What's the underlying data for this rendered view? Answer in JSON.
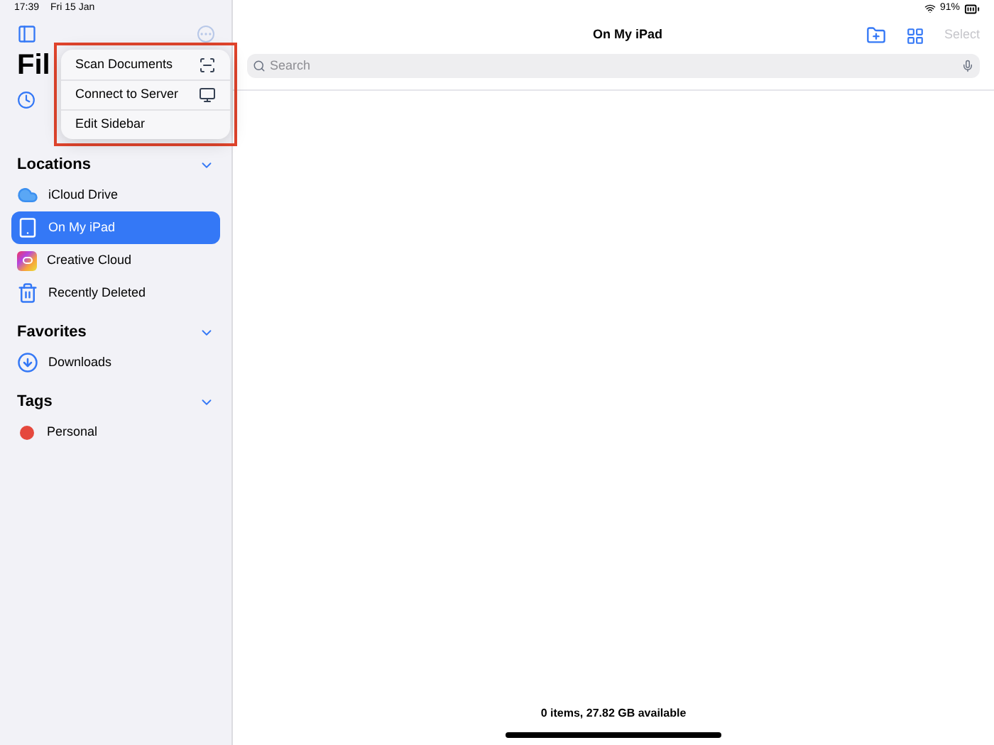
{
  "status_bar": {
    "time": "17:39",
    "date": "Fri 15 Jan",
    "battery": "91%"
  },
  "sidebar": {
    "title": "Fil",
    "sections": [
      {
        "title": "Locations",
        "expanded": true,
        "items": [
          {
            "label": "iCloud Drive",
            "kind": "cloud",
            "selected": false
          },
          {
            "label": "On My iPad",
            "kind": "device",
            "selected": true
          },
          {
            "label": "Creative Cloud",
            "kind": "app",
            "selected": false
          },
          {
            "label": "Recently Deleted",
            "kind": "trash",
            "selected": false
          }
        ]
      },
      {
        "title": "Favorites",
        "expanded": true,
        "items": [
          {
            "label": "Downloads",
            "kind": "download",
            "selected": false
          }
        ]
      },
      {
        "title": "Tags",
        "expanded": true,
        "items": [
          {
            "label": "Personal",
            "kind": "tag",
            "color": "#e5483d",
            "selected": false
          }
        ]
      }
    ]
  },
  "menu": {
    "items": [
      {
        "label": "Scan Documents",
        "kind": "scan"
      },
      {
        "label": "Connect to Server",
        "kind": "server"
      },
      {
        "label": "Edit Sidebar",
        "kind": "plain"
      }
    ]
  },
  "main": {
    "title": "On My iPad",
    "select_button": {
      "label": "Select",
      "disabled": true
    },
    "search": {
      "placeholder": "Search"
    },
    "footer": "0 items, 27.82 GB available"
  }
}
